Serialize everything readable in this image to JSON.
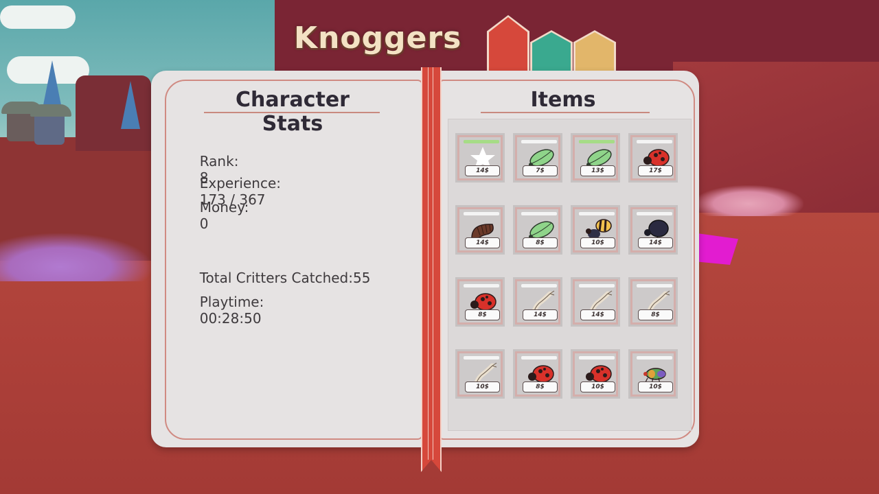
{
  "character_name": "Knoggers",
  "tabs": [
    {
      "name": "stats",
      "color": "#d6483b"
    },
    {
      "name": "tab-2",
      "color": "#3aa98f"
    },
    {
      "name": "tab-3",
      "color": "#e2b66a"
    }
  ],
  "stats": {
    "title": "Character Stats",
    "rank_label": "Rank:",
    "rank_value": "8",
    "experience_label": "Experience:",
    "experience_value": "173 / 367",
    "money_label": "Money:",
    "money_value": "0",
    "critters_label": "Total Critters Catched:",
    "critters_value": "55",
    "playtime_label": "Playtime:",
    "playtime_value": "00:28:50"
  },
  "items": {
    "title": "Items",
    "list": [
      {
        "critter": "star-icon",
        "price": "14$",
        "bar": "green"
      },
      {
        "critter": "leafhopper-icon",
        "price": "7$",
        "bar": "white"
      },
      {
        "critter": "leafhopper-icon",
        "price": "13$",
        "bar": "green"
      },
      {
        "critter": "ladybug-icon",
        "price": "17$",
        "bar": "white"
      },
      {
        "critter": "pillbug-icon",
        "price": "14$",
        "bar": "white"
      },
      {
        "critter": "leafhopper-icon",
        "price": "8$",
        "bar": "white"
      },
      {
        "critter": "bee-icon",
        "price": "10$",
        "bar": "white"
      },
      {
        "critter": "beetle-icon",
        "price": "14$",
        "bar": "white"
      },
      {
        "critter": "ladybug-icon",
        "price": "8$",
        "bar": "white"
      },
      {
        "critter": "shrimp-icon",
        "price": "14$",
        "bar": "white"
      },
      {
        "critter": "shrimp-icon",
        "price": "14$",
        "bar": "white"
      },
      {
        "critter": "shrimp-icon",
        "price": "8$",
        "bar": "white"
      },
      {
        "critter": "shrimp-icon",
        "price": "10$",
        "bar": "white"
      },
      {
        "critter": "ladybug-icon",
        "price": "8$",
        "bar": "white"
      },
      {
        "critter": "ladybug-icon",
        "price": "10$",
        "bar": "white"
      },
      {
        "critter": "colorful-bug-icon",
        "price": "10$",
        "bar": "white"
      }
    ]
  },
  "colors": {
    "accent_red": "#d6483b",
    "panel": "#e6e3e3",
    "title_text": "#2f2a36"
  }
}
